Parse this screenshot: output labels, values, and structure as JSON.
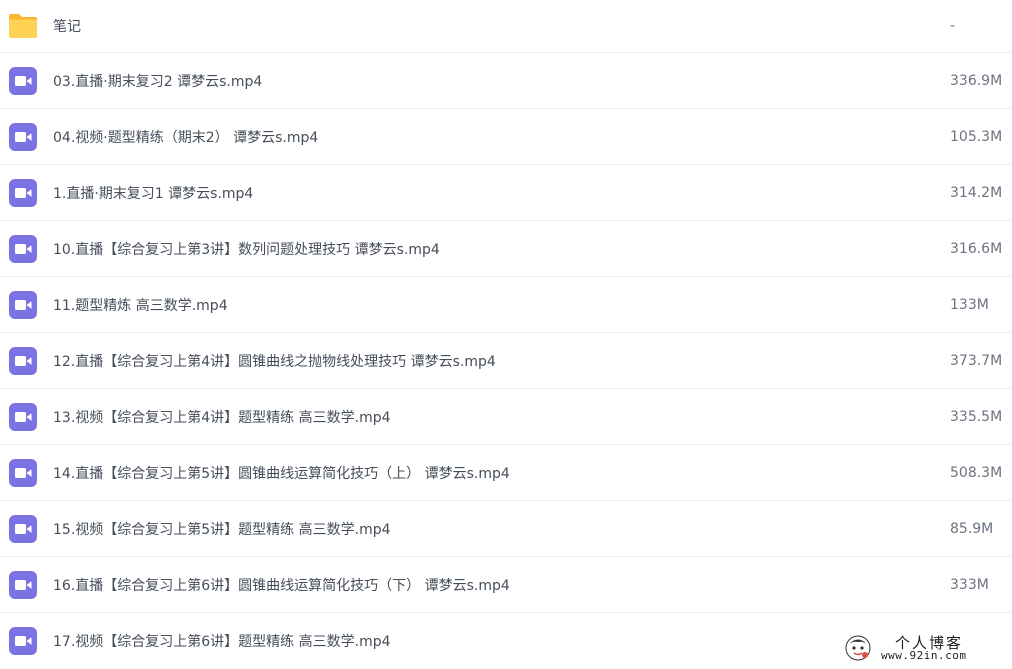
{
  "files": [
    {
      "name": "笔记",
      "size": "-",
      "icon": "folder-icon"
    },
    {
      "name": "03.直播·期末复习2 谭梦云s.mp4",
      "size": "336.9M",
      "icon": "video-icon"
    },
    {
      "name": "04.视频·题型精练（期末2） 谭梦云s.mp4",
      "size": "105.3M",
      "icon": "video-icon"
    },
    {
      "name": "1.直播·期末复习1 谭梦云s.mp4",
      "size": "314.2M",
      "icon": "video-icon"
    },
    {
      "name": "10.直播【综合复习上第3讲】数列问题处理技巧 谭梦云s.mp4",
      "size": "316.6M",
      "icon": "video-icon"
    },
    {
      "name": "11.题型精炼 高三数学.mp4",
      "size": "133M",
      "icon": "video-icon"
    },
    {
      "name": "12.直播【综合复习上第4讲】圆锥曲线之抛物线处理技巧 谭梦云s.mp4",
      "size": "373.7M",
      "icon": "video-icon"
    },
    {
      "name": "13.视频【综合复习上第4讲】题型精练 高三数学.mp4",
      "size": "335.5M",
      "icon": "video-icon"
    },
    {
      "name": "14.直播【综合复习上第5讲】圆锥曲线运算简化技巧（上） 谭梦云s.mp4",
      "size": "508.3M",
      "icon": "video-icon"
    },
    {
      "name": "15.视频【综合复习上第5讲】题型精练 高三数学.mp4",
      "size": "85.9M",
      "icon": "video-icon"
    },
    {
      "name": "16.直播【综合复习上第6讲】圆锥曲线运算简化技巧（下） 谭梦云s.mp4",
      "size": "333M",
      "icon": "video-icon"
    },
    {
      "name": "17.视频【综合复习上第6讲】题型精练 高三数学.mp4",
      "size": "",
      "icon": "video-icon"
    }
  ],
  "watermark": {
    "title": "个人博客",
    "url": "www.92in.com"
  },
  "colors": {
    "folder": "#f7c948",
    "video": "#7b73e3",
    "text": "#454d5a",
    "size_text": "#6b7280"
  }
}
